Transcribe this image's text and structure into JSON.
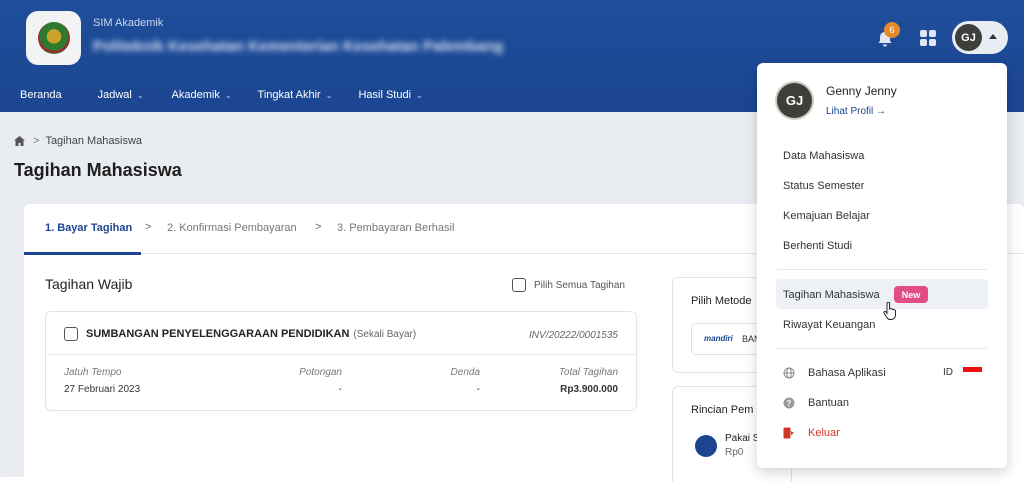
{
  "header": {
    "app_sub": "SIM Akademik",
    "institution": "Politeknik Kesehatan Kementerian Kesehatan Palembang",
    "notif_count": "6",
    "user_initials": "GJ"
  },
  "nav": {
    "items": [
      {
        "label": "Beranda",
        "chev": ""
      },
      {
        "label": "Jadwal",
        "chev": "⌄"
      },
      {
        "label": "Akademik",
        "chev": "⌄"
      },
      {
        "label": "Tingkat Akhir",
        "chev": "⌄"
      },
      {
        "label": "Hasil Studi",
        "chev": "⌄"
      }
    ]
  },
  "breadcrumb": {
    "current": "Tagihan Mahasiswa",
    "sep": ">"
  },
  "page_title": "Tagihan Mahasiswa",
  "steps": [
    {
      "label": "1. Bayar Tagihan",
      "chev": ">"
    },
    {
      "label": "2. Konfirmasi Pembayaran",
      "chev": ">"
    },
    {
      "label": "3. Pembayaran Berhasil",
      "chev": ""
    }
  ],
  "tagihan": {
    "section_title": "Tagihan Wajib",
    "select_all": "Pilih Semua Tagihan",
    "bill": {
      "name": "SUMBANGAN PENYELENGGARAAN PENDIDIKAN",
      "type": "(Sekali Bayar)",
      "invoice": "INV/20222/0001535",
      "cols": [
        {
          "label": "Jatuh Tempo",
          "value": "27 Februari 2023"
        },
        {
          "label": "Potongan",
          "value": "-"
        },
        {
          "label": "Denda",
          "value": "-"
        },
        {
          "label": "Total Tagihan",
          "value": "Rp3.900.000"
        }
      ]
    }
  },
  "side": {
    "metode_title": "Pilih Metode",
    "bank_logo": "mandiri",
    "bank_label": "BAN",
    "rincian_title": "Rincian Pem",
    "pakai_label": "Pakai S",
    "pakai_value": "Rp0"
  },
  "dropdown": {
    "initials": "GJ",
    "name": "Genny Jenny",
    "profile_link": "Lihat Profil →",
    "items": [
      "Data Mahasiswa",
      "Status Semester",
      "Kemajuan Belajar",
      "Berhenti Studi"
    ],
    "tagihan": "Tagihan Mahasiswa",
    "new_badge": "New",
    "riwayat": "Riwayat Keuangan",
    "bahasa": "Bahasa Aplikasi",
    "bahasa_value": "ID",
    "bantuan": "Bantuan",
    "keluar": "Keluar"
  },
  "colors": {
    "primary": "#1b4591",
    "badge_new": "#e24d86",
    "notif_badge": "#e48a2a",
    "danger": "#d0362b"
  }
}
